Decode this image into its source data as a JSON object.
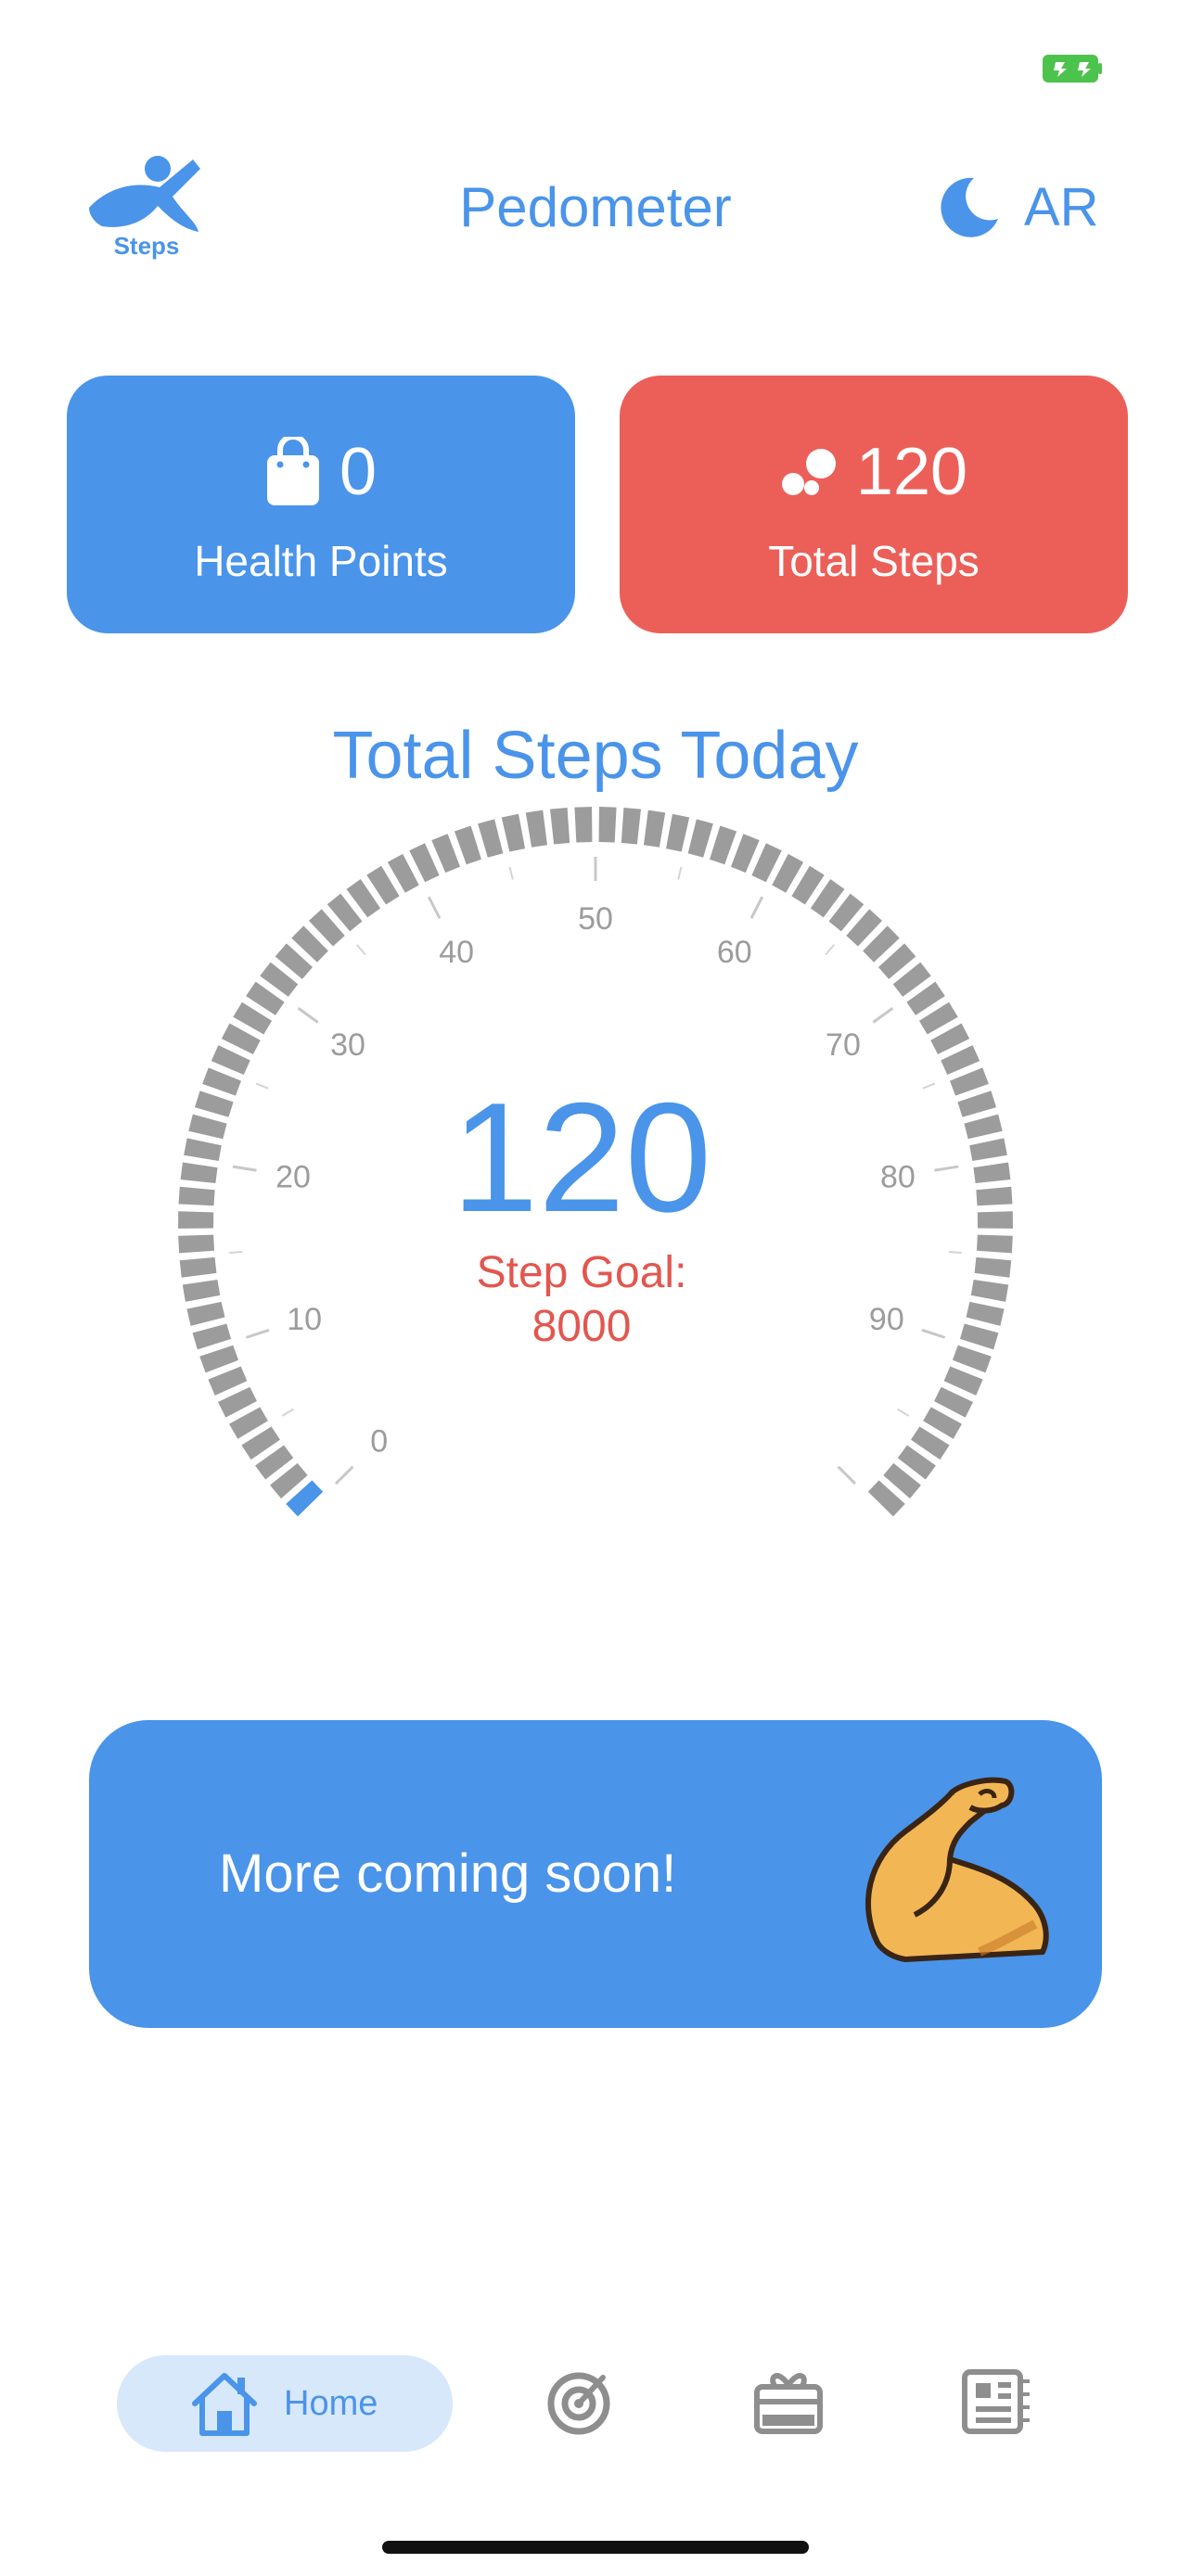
{
  "header": {
    "logo_label": "Steps",
    "title": "Pedometer",
    "language": "AR",
    "theme_icon": "moon-icon"
  },
  "stats": {
    "health_points": {
      "value": "0",
      "label": "Health Points",
      "icon": "shopping-bag-icon"
    },
    "total_steps": {
      "value": "120",
      "label": "Total Steps",
      "icon": "footsteps-icon"
    }
  },
  "gauge": {
    "title": "Total Steps Today",
    "value": "120",
    "goal_label": "Step Goal:",
    "goal_value": "8000",
    "tick_labels": [
      "0",
      "10",
      "20",
      "30",
      "40",
      "50",
      "60",
      "70",
      "80",
      "90"
    ],
    "progress_fraction": 0.015
  },
  "promo": {
    "text": "More coming soon!",
    "icon": "flexed-biceps-icon"
  },
  "tabbar": {
    "home_label": "Home",
    "items": [
      "home-icon",
      "target-icon",
      "gift-card-icon",
      "news-icon"
    ]
  },
  "colors": {
    "primary": "#4a94ea",
    "danger": "#ec5f58",
    "gauge_inactive": "#9c9c9c"
  }
}
